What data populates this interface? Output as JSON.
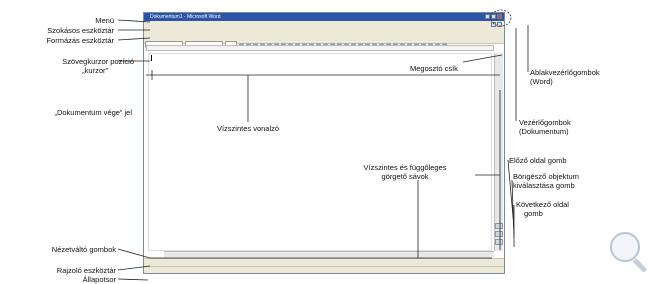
{
  "window": {
    "title": "Dokumentum1 - Microsoft Word"
  },
  "labels_left": {
    "menu": "Menü",
    "standard_toolbar": "Szokásos eszköztár",
    "format_toolbar": "Formázás eszköztár",
    "cursor_line1": "Szövegkurzor pozíció",
    "cursor_line2": "„kurzor”",
    "doc_end": "„Dokumentum vége” jel",
    "view_buttons": "Nézetváltó gombok",
    "drawing_toolbar": "Rajzoló eszköztár",
    "status_bar": "Állapotsor"
  },
  "labels_center": {
    "separator": "Megosztó csík",
    "horizontal_ruler": "Vízszintes vonalzó",
    "scrollbars_line1": "Vízszintes és függőleges",
    "scrollbars_line2": "görgető sávok"
  },
  "labels_right": {
    "app_controls_line1": "Ablakvezérlőgombok",
    "app_controls_line2": "(Word)",
    "doc_controls_line1": "Vezérlőgombok",
    "doc_controls_line2": "(Dokumentum)",
    "prev_page": "Előző oldal gomb",
    "browse_line1": "Böngésző objektum",
    "browse_line2": "kiválasztása gomb",
    "next_page_line1": "Következő oldal",
    "next_page_line2": "gomb"
  },
  "icons": {
    "zoom": "magnifier-icon"
  }
}
